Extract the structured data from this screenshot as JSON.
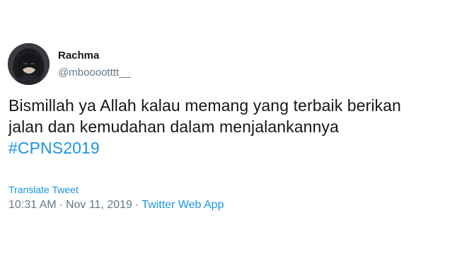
{
  "user": {
    "display_name": "Rachma",
    "handle": "@mbooootttt__"
  },
  "tweet": {
    "lines": [
      "Bismillah ya Allah kalau memang yang terbaik berikan",
      "jalan dan kemudahan dalam menjalankannya"
    ],
    "hashtag": "#CPNS2019",
    "translate_label": "Translate Tweet",
    "time": "10:31 AM",
    "separator": "·",
    "date": "Nov 11, 2019",
    "source": "Twitter Web App"
  },
  "colors": {
    "text": "#14171a",
    "secondary": "#657786",
    "link": "#1b95e0"
  },
  "icons": [
    "avatar-image"
  ]
}
